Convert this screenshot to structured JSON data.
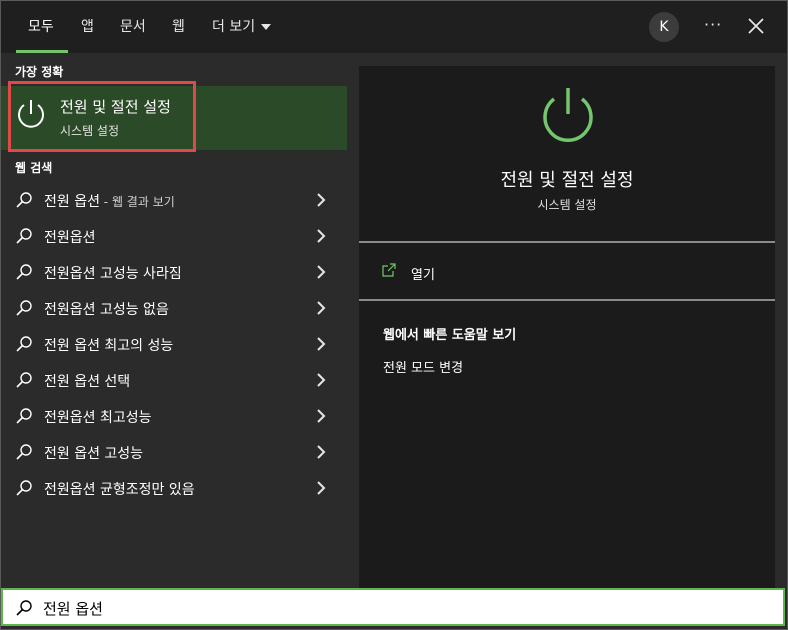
{
  "topbar": {
    "tabs": [
      {
        "label": "모두"
      },
      {
        "label": "앱"
      },
      {
        "label": "문서"
      },
      {
        "label": "웹"
      }
    ],
    "more_label": "더 보기",
    "avatar_initial": "K",
    "more_options": "···"
  },
  "left": {
    "best_match_heading": "가장 정확",
    "best_match": {
      "title": "전원 및 절전 설정",
      "subtitle": "시스템 설정",
      "icon": "power-icon"
    },
    "web_search_heading": "웹 검색",
    "web_results": [
      {
        "label": "전원 옵션",
        "suffix": " - 웹 결과 보기"
      },
      {
        "label": "전원옵션",
        "suffix": ""
      },
      {
        "label": "전원옵션 고성능 사라짐",
        "suffix": ""
      },
      {
        "label": "전원옵션 고성능 없음",
        "suffix": ""
      },
      {
        "label": "전원 옵션 최고의 성능",
        "suffix": ""
      },
      {
        "label": "전원 옵션 선택",
        "suffix": ""
      },
      {
        "label": "전원옵션 최고성능",
        "suffix": ""
      },
      {
        "label": "전원 옵션 고성능",
        "suffix": ""
      },
      {
        "label": "전원옵션 균형조정만 있음",
        "suffix": ""
      }
    ]
  },
  "right": {
    "title": "전원 및 절전 설정",
    "subtitle": "시스템 설정",
    "open_label": "열기",
    "help_heading": "웹에서 빠른 도움말 보기",
    "help_links": [
      "전원 모드 변경"
    ]
  },
  "search": {
    "query": "전원 옵션"
  },
  "colors": {
    "accent_green": "#74c66e",
    "highlight_red": "#e0484b",
    "best_match_bg": "#2b4a27"
  }
}
